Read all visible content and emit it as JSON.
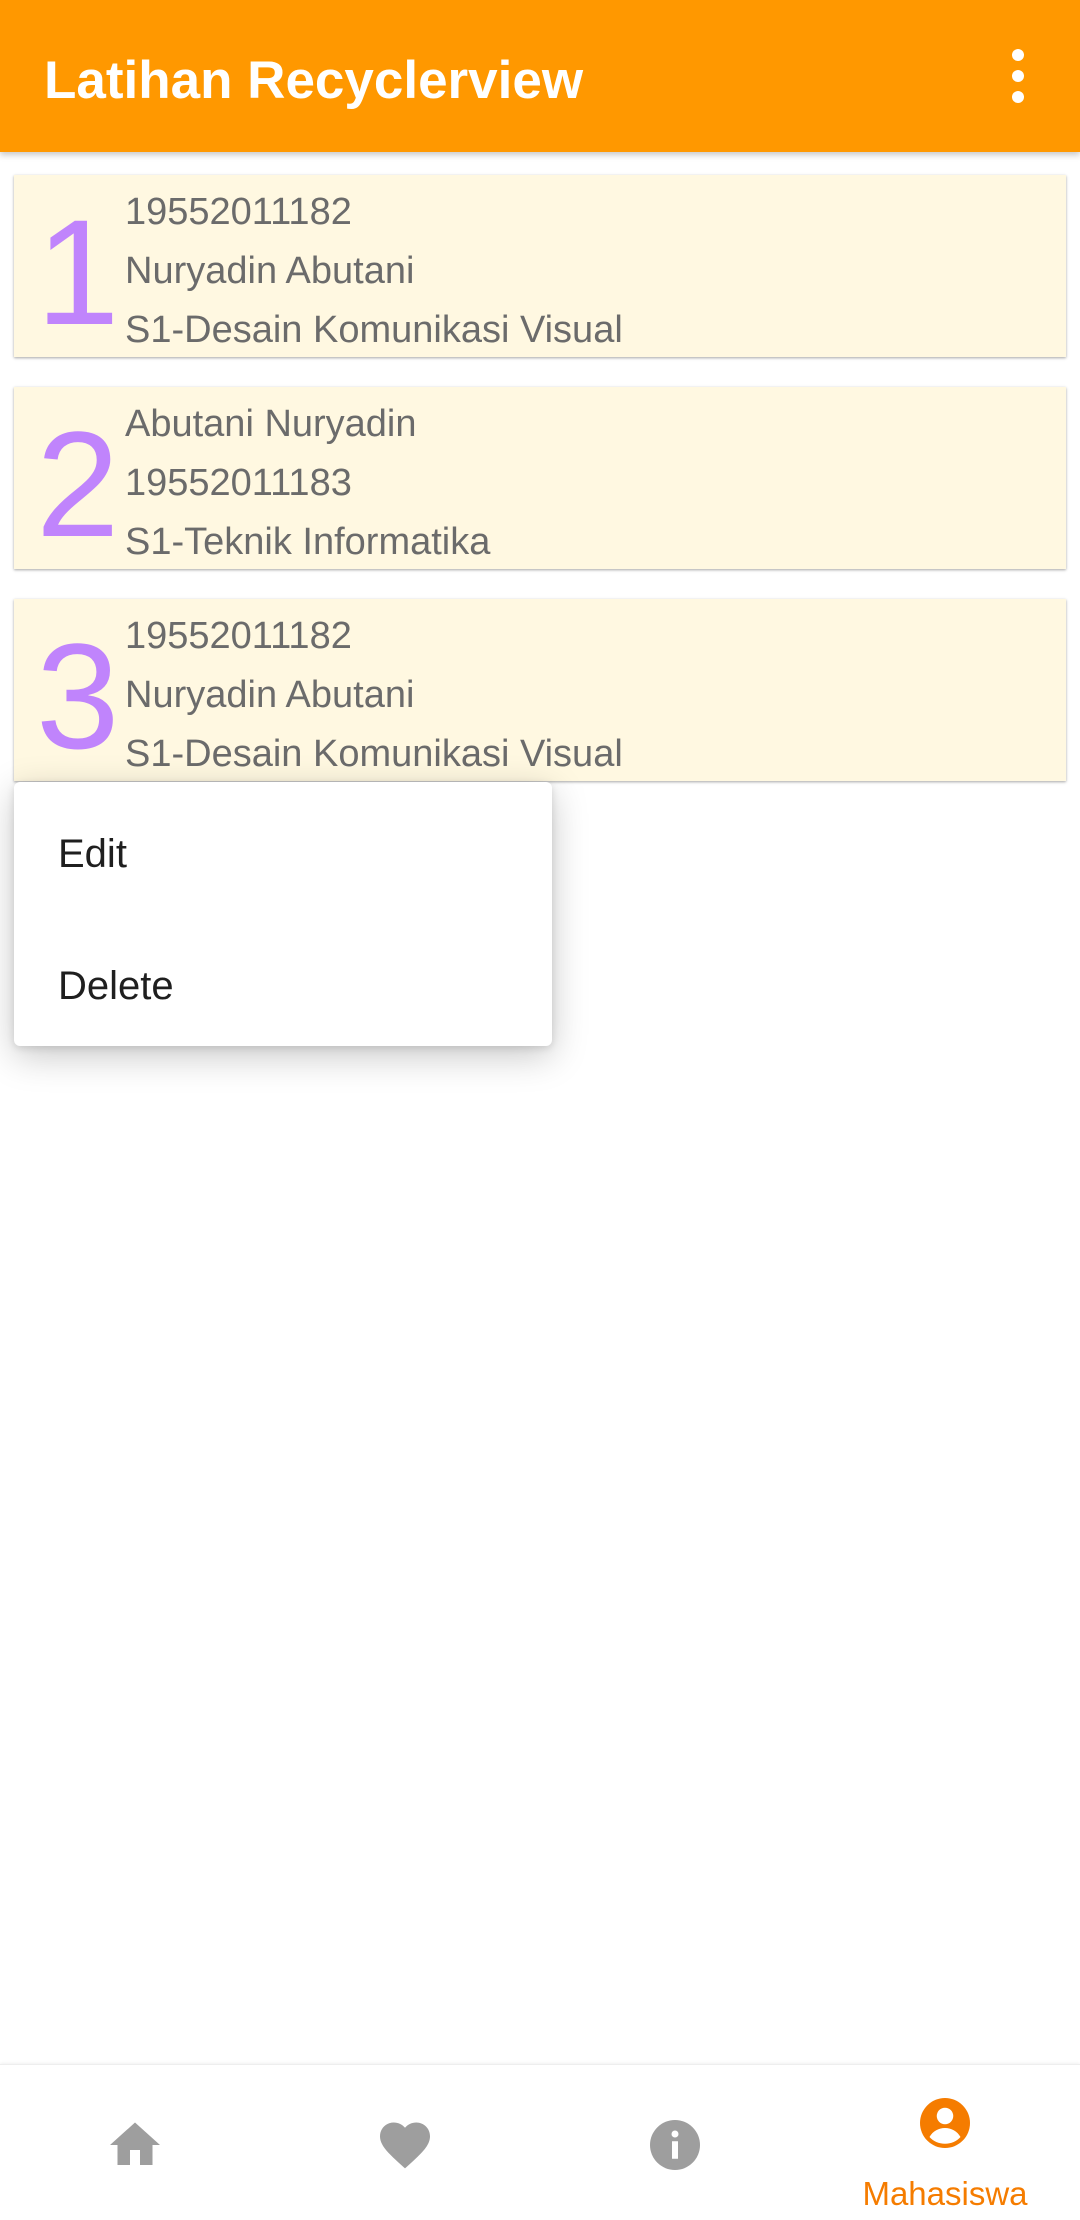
{
  "appbar": {
    "title": "Latihan Recyclerview",
    "background_color": "#FF9800",
    "overflow_icon": "more-vert-icon"
  },
  "list": {
    "items": [
      {
        "number": "1",
        "lines": [
          "19552011182",
          "Nuryadin Abutani",
          "S1-Desain Komunikasi Visual"
        ]
      },
      {
        "number": "2",
        "lines": [
          "Abutani Nuryadin",
          "19552011183",
          "S1-Teknik Informatika"
        ]
      },
      {
        "number": "3",
        "lines": [
          "19552011182",
          "Nuryadin Abutani",
          "S1-Desain Komunikasi Visual"
        ]
      }
    ],
    "card_color": "#FFF8E1",
    "number_color": "#C084FC"
  },
  "context_menu": {
    "items": [
      "Edit",
      "Delete"
    ]
  },
  "bottom_nav": {
    "items": [
      {
        "icon": "home-icon",
        "label": ""
      },
      {
        "icon": "heart-icon",
        "label": ""
      },
      {
        "icon": "info-icon",
        "label": ""
      },
      {
        "icon": "account-circle-icon",
        "label": "Mahasiswa",
        "active": true
      }
    ],
    "active_color": "#F57C00",
    "inactive_color": "#9E9E9E"
  }
}
